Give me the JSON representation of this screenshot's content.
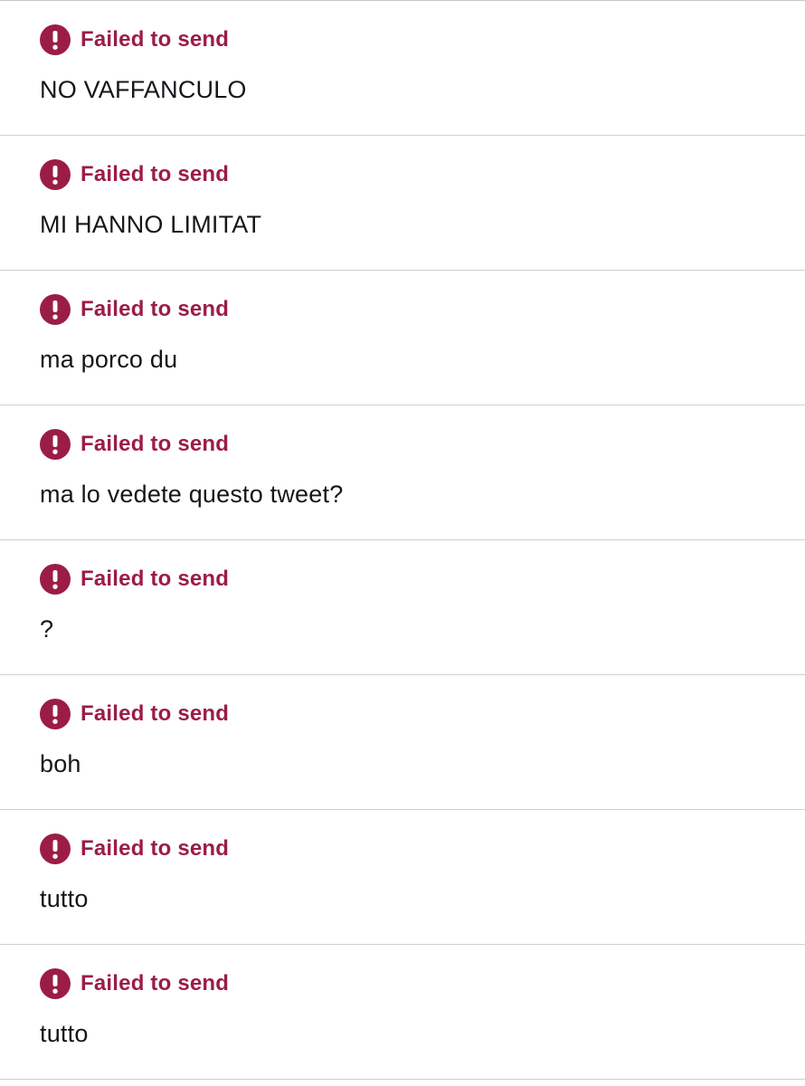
{
  "colors": {
    "error": "#9b1d45",
    "text": "#14171a",
    "divider": "#cfcfcf"
  },
  "status_icon": "exclamation-circle-icon",
  "messages": [
    {
      "status": "Failed to send",
      "text": "NO VAFFANCULO"
    },
    {
      "status": "Failed to send",
      "text": "MI HANNO LIMITAT"
    },
    {
      "status": "Failed to send",
      "text": "ma porco du"
    },
    {
      "status": "Failed to send",
      "text": "ma lo vedete questo tweet?"
    },
    {
      "status": "Failed to send",
      "text": "?"
    },
    {
      "status": "Failed to send",
      "text": "boh"
    },
    {
      "status": "Failed to send",
      "text": "tutto"
    },
    {
      "status": "Failed to send",
      "text": "tutto"
    }
  ]
}
